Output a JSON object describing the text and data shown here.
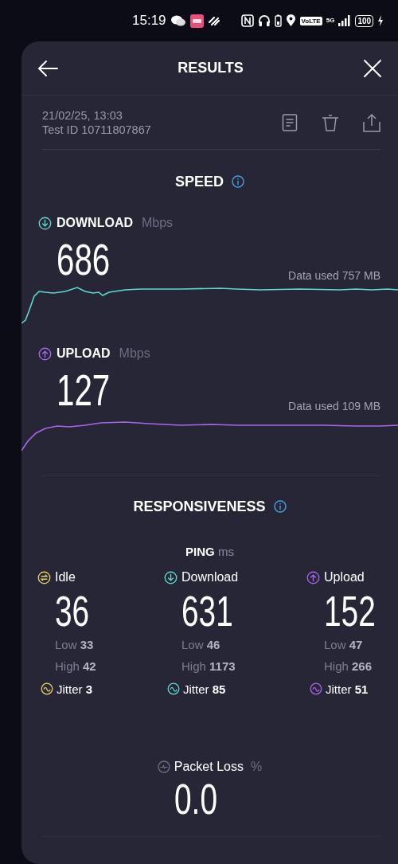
{
  "status_bar": {
    "time": "15:19",
    "volte": "VoLTE",
    "network": "5G",
    "battery": "100"
  },
  "header": {
    "title": "RESULTS"
  },
  "test": {
    "date": "21/02/25, 13:03",
    "test_id": "Test ID 10711807867"
  },
  "speed": {
    "title": "SPEED",
    "results": [
      {
        "kind": "download",
        "label": "DOWNLOAD",
        "unit": "Mbps",
        "value": "686",
        "data_used": "Data used 757 MB"
      },
      {
        "kind": "upload",
        "label": "UPLOAD",
        "unit": "Mbps",
        "value": "127",
        "data_used": "Data used 109 MB"
      }
    ]
  },
  "responsiveness": {
    "title": "RESPONSIVENESS",
    "ping_label": "PING",
    "ping_unit": "ms",
    "columns": [
      {
        "kind": "idle",
        "label": "Idle",
        "value": "36",
        "low": "Low **33**",
        "high": "High **42**",
        "jitter": "Jitter **3**"
      },
      {
        "kind": "download",
        "label": "Download",
        "value": "631",
        "low": "Low **46**",
        "high": "High **1173**",
        "jitter": "Jitter **85**"
      },
      {
        "kind": "upload",
        "label": "Upload",
        "value": "152",
        "low": "Low **47**",
        "high": "High **266**",
        "jitter": "Jitter **51**"
      }
    ]
  },
  "packet_loss": {
    "label": "Packet Loss",
    "unit": "%",
    "value": "0.0"
  }
}
